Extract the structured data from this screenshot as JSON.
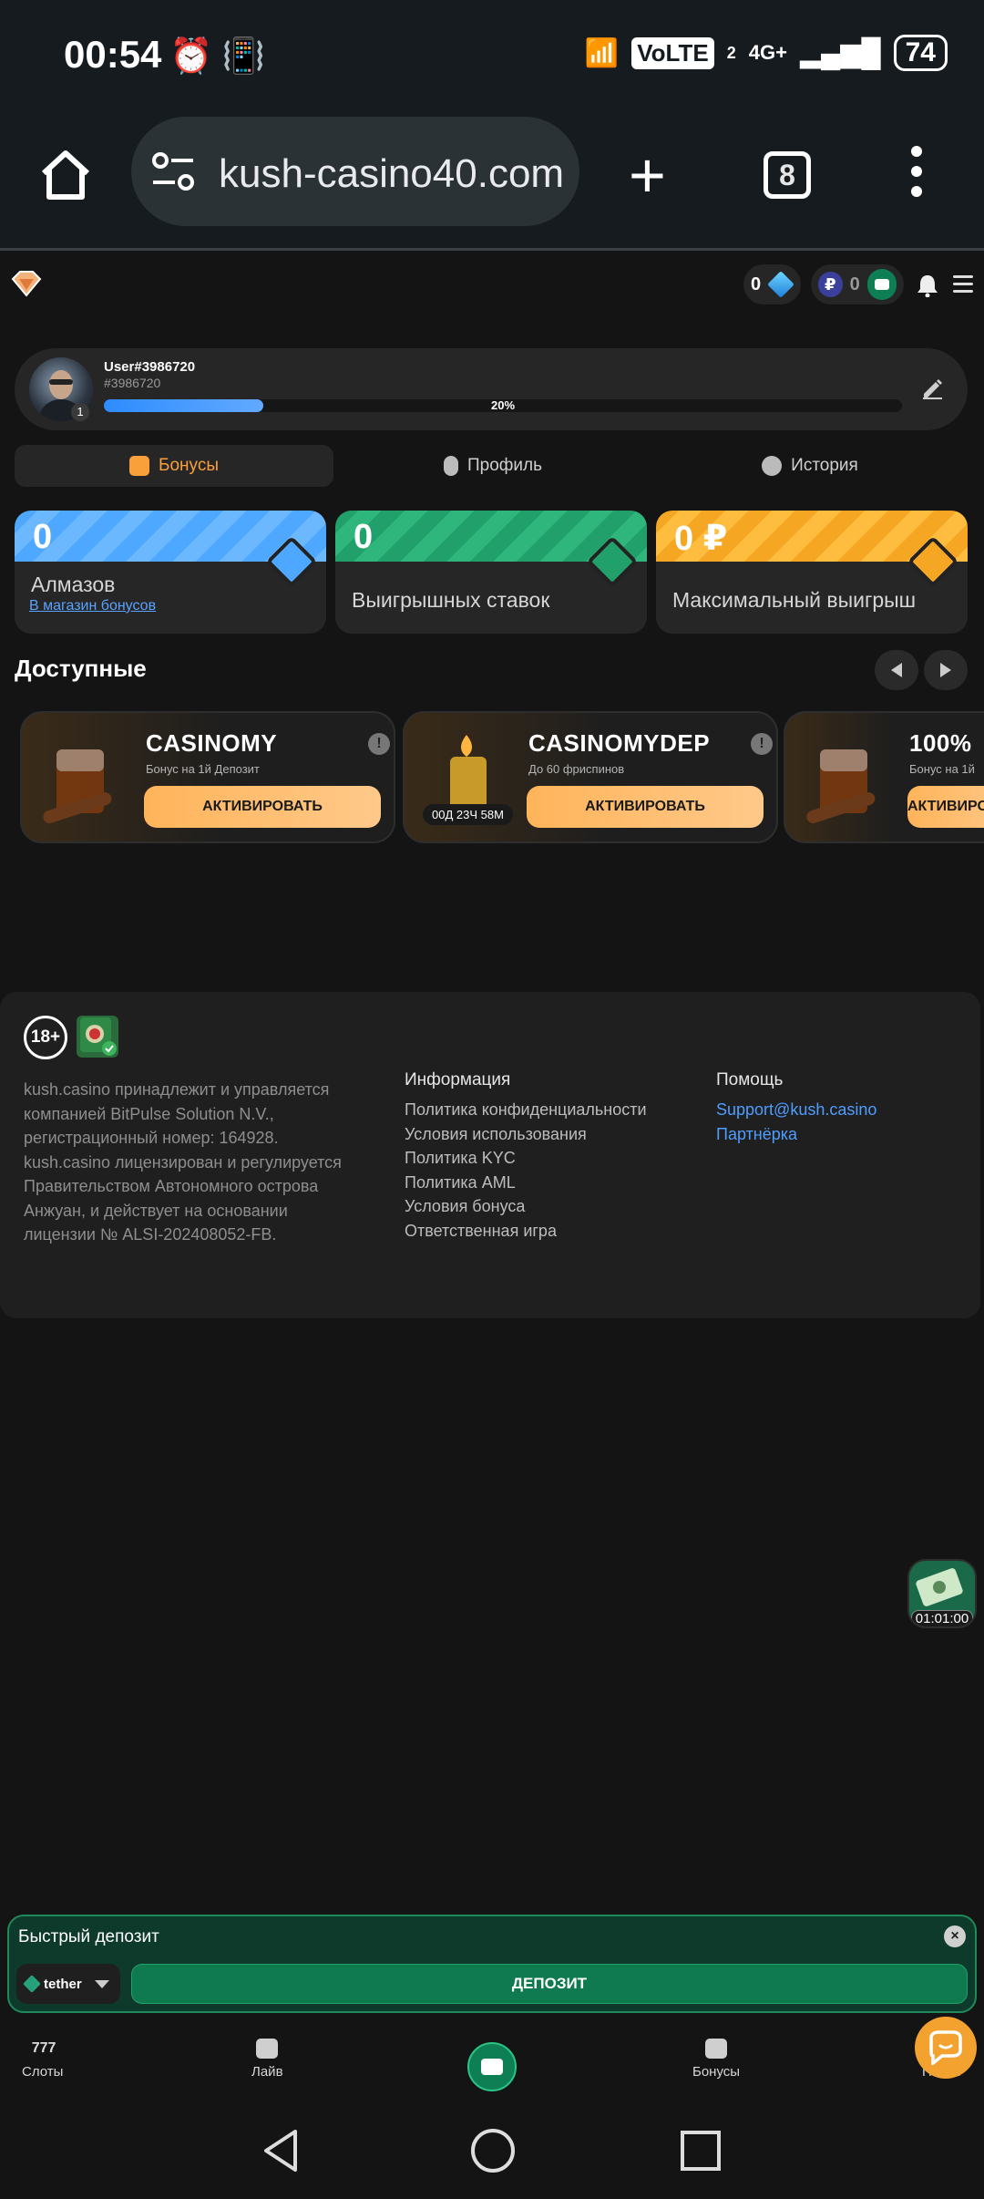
{
  "status_bar": {
    "time": "00:54",
    "network_label": "VoLTE",
    "network_sim": "2",
    "network_type": "4G+",
    "battery": "74"
  },
  "browser": {
    "url": "kush-casino40.com",
    "tab_count": "8"
  },
  "header": {
    "diamonds": "0",
    "balance": "0"
  },
  "profile": {
    "username": "User#3986720",
    "user_id": "#3986720",
    "level": "1",
    "progress_pct": 20,
    "progress_label": "20%"
  },
  "tabs": [
    {
      "label": "Бонусы",
      "active": true
    },
    {
      "label": "Профиль",
      "active": false
    },
    {
      "label": "История",
      "active": false
    }
  ],
  "stats": [
    {
      "value": "0",
      "label": "Алмазов",
      "link": "В магазин бонусов",
      "color": "#4ea8ff"
    },
    {
      "value": "0",
      "label": "Выигрышных ставок",
      "color": "#22a06b"
    },
    {
      "value": "0 ₽",
      "label": "Максимальный выигрыш",
      "color": "#f5a623"
    }
  ],
  "available": {
    "title": "Доступные"
  },
  "bonuses": [
    {
      "title": "CASINOMY",
      "desc": "Бонус на 1й Депозит",
      "button": "АКТИВИРОВАТЬ"
    },
    {
      "title": "CASINOMYDEP",
      "desc": "До 60 фриспинов",
      "button": "АКТИВИРОВАТЬ",
      "timer": "00Д 23Ч 58М"
    },
    {
      "title": "100%",
      "desc": "Бонус на 1й",
      "button": "АКТИВИРОВАТЬ"
    }
  ],
  "footer": {
    "age": "18+",
    "legal": "kush.casino принадлежит и управляется компанией BitPulse Solution N.V., регистрационный номер: 164928. kush.casino лицензирован и регулируется Правительством Автономного острова Анжуан, и действует на основании лицензии № ALSI-202408052-FB.",
    "info_title": "Информация",
    "info_links": [
      "Политика конфиденциальности",
      "Условия использования",
      "Политика KYC",
      "Политика AML",
      "Условия бонуса",
      "Ответственная игра"
    ],
    "help_title": "Помощь",
    "help_links": [
      "Support@kush.casino",
      "Партнёрка"
    ]
  },
  "promo": {
    "timer": "01:01:00"
  },
  "quick_deposit": {
    "title": "Быстрый депозит",
    "currency": "tether",
    "button": "ДЕПОЗИТ"
  },
  "bottom_nav": [
    {
      "label": "Слоты"
    },
    {
      "label": "Лайв"
    },
    {
      "label": "Бонусы"
    },
    {
      "label": "Поиск"
    }
  ],
  "colors": {
    "accent": "#f9a03a",
    "green": "#0e7f54",
    "link": "#4f9dff"
  }
}
